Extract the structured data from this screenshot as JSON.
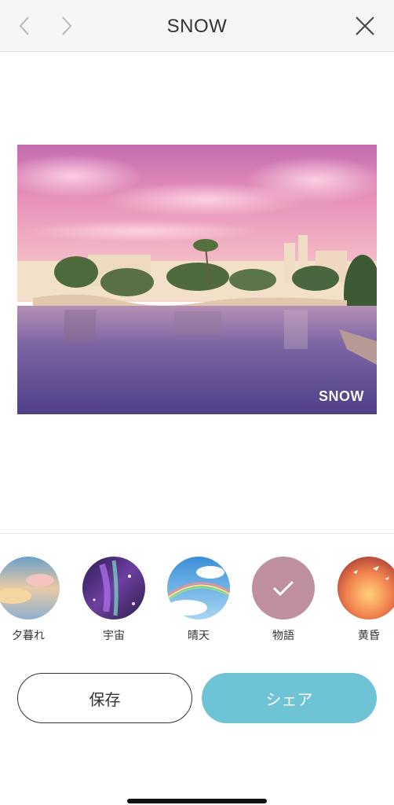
{
  "header": {
    "title": "SNOW",
    "back_icon": "chevron-left-icon",
    "forward_icon": "chevron-right-icon",
    "close_icon": "close-icon"
  },
  "photo": {
    "watermark": "SNOW"
  },
  "filters": [
    {
      "label": "夕暮れ",
      "selected": false
    },
    {
      "label": "宇宙",
      "selected": false
    },
    {
      "label": "晴天",
      "selected": false
    },
    {
      "label": "物語",
      "selected": true
    },
    {
      "label": "黄昏",
      "selected": false
    }
  ],
  "actions": {
    "save_label": "保存",
    "share_label": "シェア"
  },
  "colors": {
    "accent": "#6ec3d4",
    "header_bg": "#f6f6f6"
  }
}
